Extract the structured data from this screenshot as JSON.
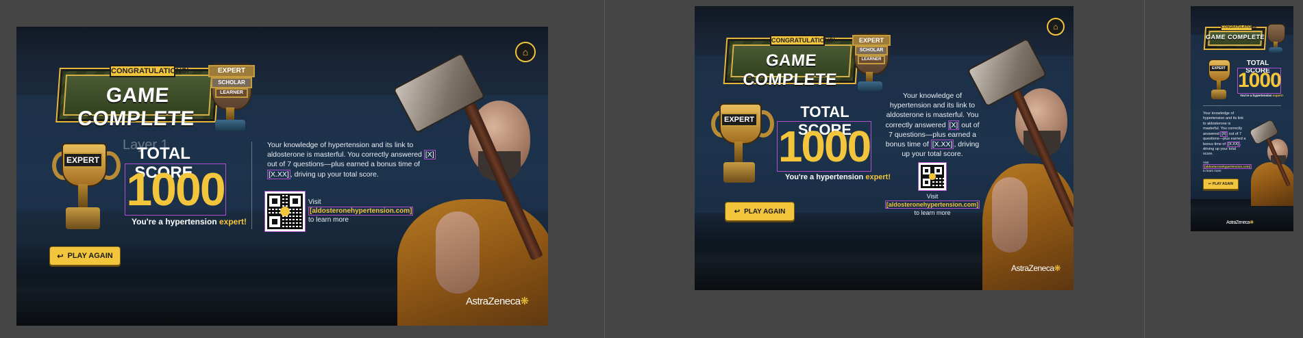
{
  "colors": {
    "canvas_bg": "#454545",
    "accent_yellow": "#f2c53c",
    "selection_purple": "#b14fd1",
    "navy": "#1d3147"
  },
  "artboards": [
    {
      "name": "desktop",
      "congrats": "CONGRATULATIONS!",
      "title": "GAME COMPLETE",
      "badge_trophy": [
        "EXPERT",
        "SCHOLAR",
        "LEARNER"
      ],
      "trophy_label": "EXPERT",
      "layer_ghost": "Layer 1",
      "score_title": "TOTAL SCORE",
      "score_value": "1000",
      "tagline_pre": "You're a hypertension ",
      "tagline_hi": "expert!",
      "para": {
        "p1": "Your knowledge of hypertension and its link to aldosterone is masterful. You correctly answered ",
        "x": "[X]",
        "p2": " out of 7 questions—plus earned a bonus time of ",
        "xx": "[X.XX]",
        "p3": ", driving up your total score."
      },
      "visit": {
        "pre": "Visit",
        "url": "[aldosteronehypertension.com]",
        "post": "to learn more"
      },
      "play_label": "PLAY AGAIN",
      "brand": "AstraZeneca"
    },
    {
      "name": "tablet",
      "congrats": "CONGRATULATIONS!",
      "title": "GAME COMPLETE",
      "badge_trophy": [
        "EXPERT",
        "SCHOLAR",
        "LEARNER"
      ],
      "trophy_label": "EXPERT",
      "score_title": "TOTAL SCORE",
      "score_value": "1000",
      "tagline_pre": "You're a hypertension ",
      "tagline_hi": "expert!",
      "para": {
        "p1": "Your knowledge of hypertension and its link to aldosterone is masterful. You correctly answered ",
        "x": "[X]",
        "p2": " out of 7 questions—plus earned a bonus time of ",
        "xx": "[X.XX]",
        "p3": ", driving up your total score."
      },
      "visit": {
        "pre": "Visit",
        "url": "[aldosteronehypertension.com]",
        "post": "to learn more"
      },
      "play_label": "PLAY AGAIN",
      "brand": "AstraZeneca"
    },
    {
      "name": "mobile",
      "congrats": "CONGRATULATIONS!",
      "title": "GAME COMPLETE",
      "trophy_label": "EXPERT",
      "score_title": "TOTAL SCORE",
      "score_value": "1000",
      "tagline_pre": "You're a hypertension ",
      "tagline_hi": "expert!",
      "para": {
        "p1": "Your knowledge of hypertension and its link to aldosterone is masterful. You correctly answered ",
        "x": "[X]",
        "p2": " out of 7 questions—plus earned a bonus time of ",
        "xx": "[X.XX]",
        "p3": ", driving up your total score."
      },
      "visit": {
        "pre": "Visit",
        "url": "[aldosteronehypertension.com]",
        "post": "to learn more"
      },
      "play_label": "PLAY AGAIN",
      "brand": "AstraZeneca"
    }
  ]
}
